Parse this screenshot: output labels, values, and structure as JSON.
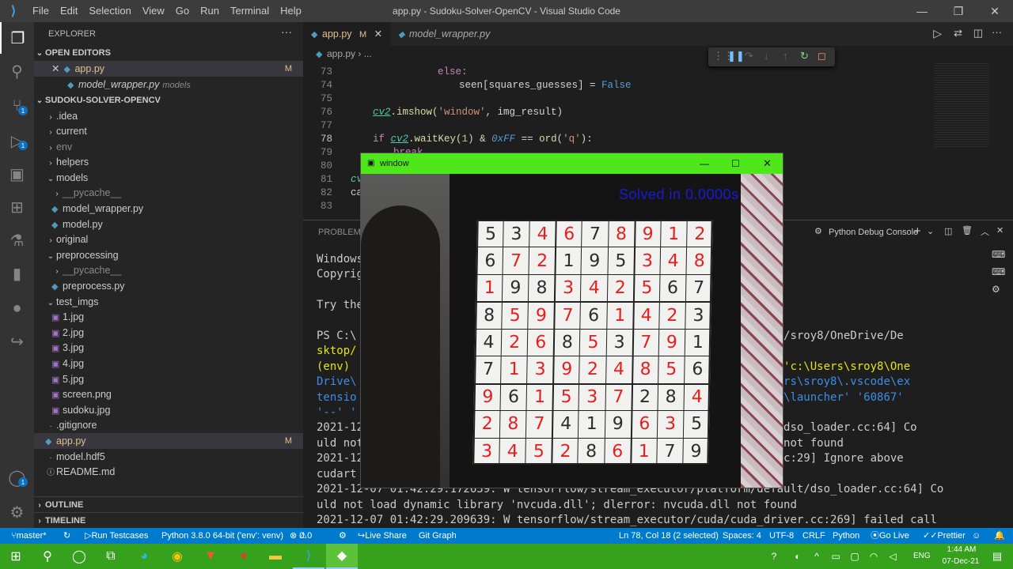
{
  "window": {
    "title": "app.py - Sudoku-Solver-OpenCV - Visual Studio Code",
    "menu": [
      "File",
      "Edit",
      "Selection",
      "View",
      "Go",
      "Run",
      "Terminal",
      "Help"
    ]
  },
  "sidebar": {
    "title": "EXPLORER",
    "open_editors_label": "OPEN EDITORS",
    "open_editors": [
      {
        "name": "app.py",
        "badge": "M"
      },
      {
        "name": "model_wrapper.py",
        "desc": "models"
      }
    ],
    "project_label": "SUDOKU-SOLVER-OPENCV",
    "tree": [
      {
        "name": ".idea",
        "type": "folder"
      },
      {
        "name": "current",
        "type": "folder"
      },
      {
        "name": "env",
        "type": "folder"
      },
      {
        "name": "helpers",
        "type": "folder"
      },
      {
        "name": "models",
        "type": "folder-open"
      },
      {
        "name": "__pycache__",
        "type": "folder"
      },
      {
        "name": "model_wrapper.py",
        "type": "py"
      },
      {
        "name": "model.py",
        "type": "py"
      },
      {
        "name": "original",
        "type": "folder"
      },
      {
        "name": "preprocessing",
        "type": "folder-open"
      },
      {
        "name": "__pycache__",
        "type": "folder"
      },
      {
        "name": "preprocess.py",
        "type": "py"
      },
      {
        "name": "test_imgs",
        "type": "folder-open"
      },
      {
        "name": "1.jpg",
        "type": "img"
      },
      {
        "name": "2.jpg",
        "type": "img"
      },
      {
        "name": "3.jpg",
        "type": "img"
      },
      {
        "name": "4.jpg",
        "type": "img"
      },
      {
        "name": "5.jpg",
        "type": "img"
      },
      {
        "name": "screen.png",
        "type": "img"
      },
      {
        "name": "sudoku.jpg",
        "type": "img"
      },
      {
        "name": ".gitignore",
        "type": "file"
      },
      {
        "name": "app.py",
        "type": "py",
        "badge": "M"
      },
      {
        "name": "model.hdf5",
        "type": "file"
      },
      {
        "name": "README.md",
        "type": "file"
      }
    ],
    "outline_label": "OUTLINE",
    "timeline_label": "TIMELINE"
  },
  "tabs": [
    {
      "name": "app.py",
      "badge": "M"
    },
    {
      "name": "model_wrapper.py"
    }
  ],
  "breadcrumb": {
    "file": "app.py",
    "rest": "..."
  },
  "code_lines": [
    {
      "n": "73"
    },
    {
      "n": "74"
    },
    {
      "n": "75"
    },
    {
      "n": "76"
    },
    {
      "n": "77"
    },
    {
      "n": "78"
    },
    {
      "n": "79"
    },
    {
      "n": "80"
    },
    {
      "n": "81"
    },
    {
      "n": "82"
    },
    {
      "n": "83"
    }
  ],
  "code": {
    "l73": "else:",
    "l74a": "seen[squares_guesses] = ",
    "l74b": "False",
    "l76a": "cv2",
    "l76b": ".imshow(",
    "l76c": "'window'",
    "l76d": ", img_result)",
    "l78a": "if ",
    "l78b": "cv2",
    "l78c": ".waitKey(",
    "l78d": "1",
    "l78e": ") & ",
    "l78f": "0xFF",
    "l78g": " == ",
    "l78h": "ord",
    "l78i": "(",
    "l78j": "'q'",
    "l78k": "):",
    "l79": "break",
    "l81": "cv",
    "l82": "ca"
  },
  "panel": {
    "problems_label": "PROBLEMS",
    "console_select": "Python Debug Console",
    "console_lines": [
      "Windows",
      "Copyrig",
      "",
      "Try the",
      "",
      "PS C:\\                                                        c:/Users/sroy8/OneDrive/De",
      "sktop/                                                         ",
      "(env)                                                          CV>  & 'c:\\Users\\sroy8\\One",
      "Drive\\                                                         'c:\\Users\\sroy8\\.vscode\\ex",
      "tensio                                                         debugpy\\launcher' '60867'",
      "'--' '                                                         app.py'",
      "2021-12                                                        efault/dso_loader.cc:64] Co",
      "uld not                                                        10.dll not found",
      "2021-12                                                        _stub.cc:29] Ignore above",
      "cudart",
      "2021-12-07 01:42:29.172639: W tensorflow/stream_executor/platform/default/dso_loader.cc:64] Co",
      "uld not load dynamic library 'nvcuda.dll'; dlerror: nvcuda.dll not found",
      "2021-12-07 01:42:29.209639: W tensorflow/stream_executor/cuda/cuda_driver.cc:269] failed call"
    ]
  },
  "cv_window": {
    "title": "window",
    "overlay_text": "Solved in 0.0000s",
    "grid": [
      [
        5,
        3,
        4,
        6,
        7,
        8,
        9,
        1,
        2
      ],
      [
        6,
        7,
        2,
        1,
        9,
        5,
        3,
        4,
        8
      ],
      [
        1,
        9,
        8,
        3,
        4,
        2,
        5,
        6,
        7
      ],
      [
        8,
        5,
        9,
        7,
        6,
        1,
        4,
        2,
        3
      ],
      [
        4,
        2,
        6,
        8,
        5,
        3,
        7,
        9,
        1
      ],
      [
        7,
        1,
        3,
        9,
        2,
        4,
        8,
        5,
        6
      ],
      [
        9,
        6,
        1,
        5,
        3,
        7,
        2,
        8,
        4
      ],
      [
        2,
        8,
        7,
        4,
        1,
        9,
        6,
        3,
        5
      ],
      [
        3,
        4,
        5,
        2,
        8,
        6,
        1,
        7,
        9
      ]
    ],
    "solved_mask": [
      [
        0,
        0,
        1,
        1,
        0,
        1,
        1,
        1,
        1
      ],
      [
        0,
        1,
        1,
        0,
        0,
        0,
        1,
        1,
        1
      ],
      [
        1,
        0,
        0,
        1,
        1,
        1,
        1,
        0,
        0
      ],
      [
        0,
        1,
        1,
        1,
        0,
        1,
        1,
        1,
        0
      ],
      [
        0,
        1,
        1,
        0,
        1,
        0,
        1,
        1,
        0
      ],
      [
        0,
        1,
        1,
        1,
        1,
        1,
        1,
        1,
        0
      ],
      [
        1,
        0,
        1,
        1,
        1,
        1,
        0,
        0,
        1
      ],
      [
        1,
        1,
        1,
        0,
        0,
        0,
        1,
        1,
        0
      ],
      [
        1,
        1,
        1,
        1,
        0,
        1,
        1,
        0,
        0
      ]
    ],
    "colors": {
      "given": "#2c2c2c",
      "solved": "#e81e1e",
      "overlay": "#1a1ad8"
    }
  },
  "status": {
    "branch": "master*",
    "run": "Run Testcases",
    "python": "Python 3.8.0 64-bit ('env': venv)",
    "errors": "0",
    "warnings": "0",
    "live_share": "Live Share",
    "git_graph": "Git Graph",
    "cursor": "Ln 78, Col 18 (2 selected)",
    "spaces": "Spaces: 4",
    "encoding": "UTF-8",
    "eol": "CRLF",
    "language": "Python",
    "go_live": "Go Live",
    "prettier": "Prettier"
  },
  "taskbar": {
    "lang": "ENG",
    "time": "1:44 AM",
    "date": "07-Dec-21"
  },
  "colors": {
    "accent": "#007acc",
    "titlebar": "#3c3c3c",
    "cv_title": "#4fe61b",
    "taskbar": "#36a11c"
  }
}
